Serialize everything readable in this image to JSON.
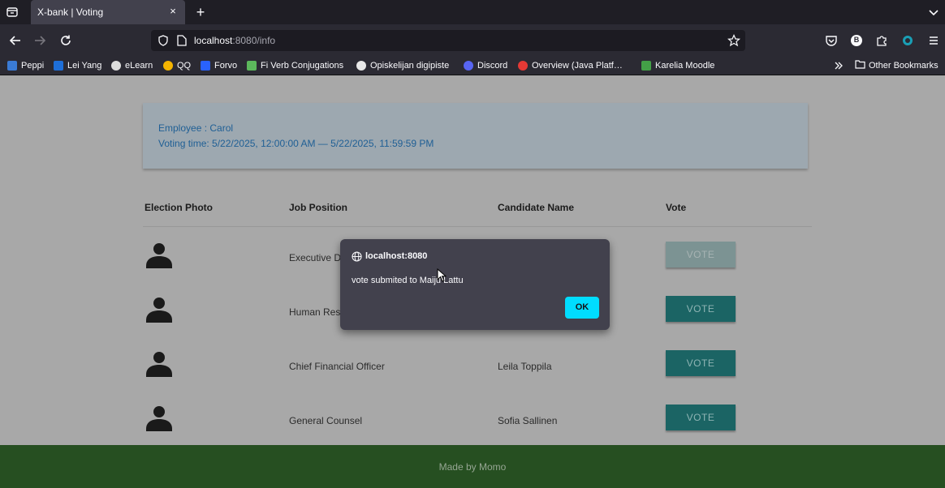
{
  "browser": {
    "tab_title": "X-bank | Voting",
    "tab_close": "×",
    "new_tab": "+",
    "url_host": "localhost",
    "url_path": ":8080/info",
    "profile_letter": "B",
    "icons": {
      "tab_list": "tab-list-icon",
      "back": "back-arrow-icon",
      "forward": "forward-arrow-icon",
      "reload": "reload-icon",
      "shield": "tracking-shield-icon",
      "page": "page-icon",
      "bookmark_star": "star-icon",
      "pocket": "pocket-icon",
      "extensions": "puzzle-icon",
      "menu": "hamburger-menu-icon"
    },
    "bookmarks": [
      {
        "label": "Peppi",
        "color": "#3a7bd5"
      },
      {
        "label": "Lei Yang",
        "color": "#1e6fd9"
      },
      {
        "label": "eLearn",
        "color": "#dddddd"
      },
      {
        "label": "QQ",
        "color": "#f4b400"
      },
      {
        "label": "Forvo",
        "color": "#2962ff"
      },
      {
        "label": "Fi Verb Conjugations",
        "color": "#5cb85c"
      },
      {
        "label": "Opiskelijan digipiste",
        "color": "#e8e8e8"
      },
      {
        "label": "Discord",
        "color": "#5865f2"
      },
      {
        "label": "Overview (Java Platf…",
        "color": "#e53935"
      },
      {
        "label": "Karelia Moodle",
        "color": "#43a047"
      }
    ],
    "other_bookmarks": "Other Bookmarks"
  },
  "info": {
    "employee": "Employee : Carol",
    "voting_time": "Voting time: 5/22/2025, 12:00:00 AM — 5/22/2025, 11:59:59 PM"
  },
  "table": {
    "headers": [
      "Election Photo",
      "Job Position",
      "Candidate Name",
      "Vote"
    ],
    "rows": [
      {
        "position": "Executive D",
        "candidate": "",
        "vote": "VOTE",
        "disabled": true
      },
      {
        "position": "Human Res",
        "candidate": "",
        "vote": "VOTE",
        "disabled": false
      },
      {
        "position": "Chief Financial Officer",
        "candidate": "Leila Toppila",
        "vote": "VOTE",
        "disabled": false
      },
      {
        "position": "General Counsel",
        "candidate": "Sofia Sallinen",
        "vote": "VOTE",
        "disabled": false
      }
    ]
  },
  "footer": {
    "text": "Made by Momo"
  },
  "dialog": {
    "title": "localhost:8080",
    "message": "vote submited to Maiju Lattu",
    "ok_label": "OK"
  },
  "colors": {
    "accent_cyan": "#00ddff",
    "vote_button": "#1b6464",
    "footer_green": "#264f21",
    "info_text": "#1f5f95"
  }
}
